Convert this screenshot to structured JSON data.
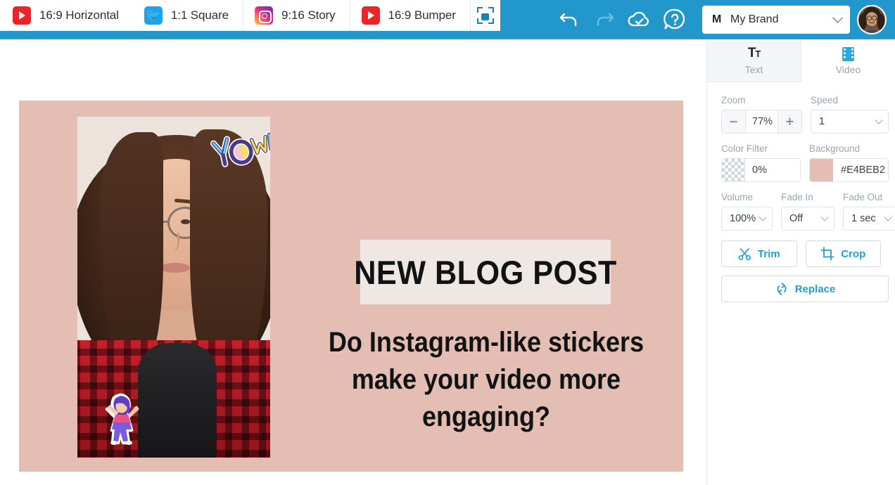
{
  "topbar": {
    "format_tabs": [
      {
        "label": "16:9 Horizontal",
        "icon": "youtube-icon",
        "platform": "youtube",
        "active": true
      },
      {
        "label": "1:1 Square",
        "icon": "twitter-icon",
        "platform": "twitter",
        "active": false
      },
      {
        "label": "9:16 Story",
        "icon": "instagram-icon",
        "platform": "instagram",
        "active": false
      },
      {
        "label": "16:9 Bumper",
        "icon": "youtube-icon",
        "platform": "youtube",
        "active": false
      }
    ],
    "expand_button": {
      "name": "expand-formats-button",
      "icon": "expand-icon"
    },
    "undo": {
      "label": "Undo",
      "icon": "undo-icon",
      "enabled": true
    },
    "redo": {
      "label": "Redo",
      "icon": "redo-icon",
      "enabled": false
    },
    "save_status": {
      "label": "Saved",
      "icon": "cloud-check-icon"
    },
    "help": {
      "label": "Help",
      "icon": "help-circle-icon"
    },
    "brand": {
      "initial": "M",
      "name": "My Brand",
      "chevron": "chevron-down-icon"
    },
    "avatar": {
      "name": "user-avatar",
      "alt": "User profile photo"
    },
    "bar_color": "#2197CC"
  },
  "canvas": {
    "background_color": "#E4BEB2",
    "title_text": "NEW BLOG POST",
    "title_box_color": "#EFE7E3",
    "subtitle_line1": "Do Instagram-like stickers",
    "subtitle_line2": "make your video more engaging?",
    "video_clip": {
      "name": "video-clip",
      "alt": "Woman with glasses in red plaid shirt"
    },
    "stickers": [
      {
        "name": "yow-sticker",
        "text": "Yow!",
        "position": "top-right"
      },
      {
        "name": "dancing-figure-sticker",
        "text": "",
        "position": "bottom-left"
      }
    ]
  },
  "panel": {
    "tabs": [
      {
        "label": "Text",
        "icon": "text-format-icon",
        "active": false
      },
      {
        "label": "Video",
        "icon": "film-strip-icon",
        "active": true
      }
    ],
    "zoom": {
      "label": "Zoom",
      "value": "77%",
      "minus": "−",
      "plus": "+"
    },
    "speed": {
      "label": "Speed",
      "value": "1"
    },
    "color_filter": {
      "label": "Color Filter",
      "value": "0%",
      "swatch": "transparent-checker"
    },
    "background": {
      "label": "Background",
      "value": "#E4BEB2",
      "swatch_color": "#E4BEB2"
    },
    "volume": {
      "label": "Volume",
      "value": "100%"
    },
    "fade_in": {
      "label": "Fade In",
      "value": "Off"
    },
    "fade_out": {
      "label": "Fade Out",
      "value": "1 sec"
    },
    "trim": {
      "label": "Trim",
      "icon": "scissors-icon"
    },
    "crop": {
      "label": "Crop",
      "icon": "crop-icon"
    },
    "replace": {
      "label": "Replace",
      "icon": "refresh-icon"
    },
    "accent_color": "#1F9FD4"
  }
}
